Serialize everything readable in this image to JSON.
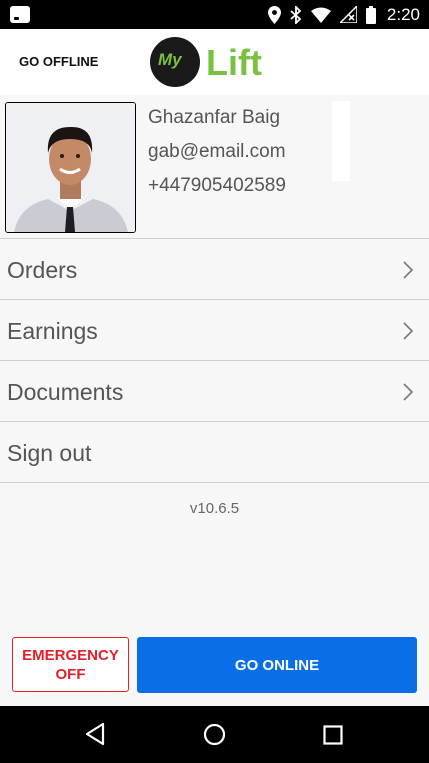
{
  "status_bar": {
    "time": "2:20",
    "icons": [
      "notification-icon",
      "location-icon",
      "bluetooth-icon",
      "wifi-icon",
      "no-signal-icon",
      "battery-icon"
    ]
  },
  "header": {
    "go_offline_label": "GO OFFLINE",
    "logo_my": "My",
    "logo_lift": "Lift",
    "logo_color": "#7ac142"
  },
  "profile": {
    "name": "Ghazanfar Baig",
    "email": "gab@email.com",
    "phone": "+447905402589"
  },
  "menu": {
    "items": [
      {
        "label": "Orders",
        "has_chevron": true
      },
      {
        "label": "Earnings",
        "has_chevron": true
      },
      {
        "label": "Documents",
        "has_chevron": true
      },
      {
        "label": "Sign out",
        "has_chevron": false
      }
    ]
  },
  "version": "v10.6.5",
  "buttons": {
    "emergency_line1": "EMERGENCY",
    "emergency_line2": "OFF",
    "emergency_color": "#e01f26",
    "go_online": "GO ONLINE",
    "go_online_color": "#0a6fe6"
  },
  "nav_bar": {
    "icons": [
      "back-icon",
      "home-icon",
      "recent-apps-icon"
    ]
  }
}
